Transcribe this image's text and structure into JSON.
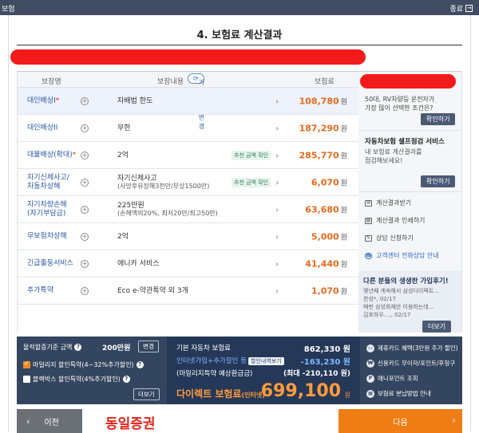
{
  "window": {
    "title": "보험",
    "close_label": "종료",
    "close_icon": "exit-icon"
  },
  "page": {
    "title": "4. 보험료 계산결과"
  },
  "table": {
    "headers": {
      "name": "보장명",
      "coverage": "보장내용",
      "change_amount": "가입금액 변경",
      "premium": "보험료"
    },
    "rows": [
      {
        "name": "대인배상I",
        "required": "*",
        "coverage": "자배법 한도",
        "coverage_sub": "",
        "recommend": "",
        "amount": "108,780",
        "unit": "원"
      },
      {
        "name": "대인배상II",
        "required": "",
        "coverage": "무한",
        "coverage_sub": "",
        "recommend": "",
        "amount": "187,290",
        "unit": "원"
      },
      {
        "name": "대물배상(확대)",
        "required": "*",
        "coverage": "2억",
        "coverage_sub": "",
        "recommend": "추천 금액 확인",
        "amount": "285,770",
        "unit": "원"
      },
      {
        "name": "자기신체사고/",
        "name2": "자동차상해",
        "required": "",
        "coverage": "자기신체사고",
        "coverage_sub": "(사망후유장해3천만/부상1500만)",
        "recommend": "추천 금액 확인",
        "amount": "6,070",
        "unit": "원"
      },
      {
        "name": "자기차량손해",
        "name2": "(자기부담금)",
        "required": "",
        "coverage": "225만원",
        "coverage_sub": "(손해액의20%, 최저20만/최고50만)",
        "recommend": "",
        "amount": "63,680",
        "unit": "원"
      },
      {
        "name": "무보험차상해",
        "required": "",
        "coverage": "2억",
        "coverage_sub": "",
        "recommend": "",
        "amount": "5,000",
        "unit": "원"
      },
      {
        "name": "긴급출동서비스",
        "required": "",
        "coverage": "애니카 서비스",
        "coverage_sub": "",
        "recommend": "",
        "amount": "41,440",
        "unit": "원"
      },
      {
        "name": "추가특약",
        "required": "",
        "coverage": "Eco e-약관특약 외 3개",
        "coverage_sub": "",
        "recommend": "",
        "amount": "1,070",
        "unit": "원"
      }
    ]
  },
  "side": {
    "question_line1": "50대, RV차량등 운전자가",
    "question_line2": "가장 많이 선택한 조건은?",
    "confirm1": "확인하기",
    "check_title": "자동차보험 셀프점검 서비스",
    "check_line1": "내 보험료 계산결과를",
    "check_line2": "점검해보세요!",
    "confirm2": "확인하기",
    "links": [
      "계산결과받기",
      "계산결과 인쇄하기",
      "상담 신청하기"
    ],
    "consult_link": "고객센터 전화상담 안내",
    "review_title": "다른 분들의 생생한 가입후기!",
    "review_line1": "몇년째 계속해서 삼성다이렉트...",
    "review_line2": "찬성*, 02/17",
    "review_line3": "매번 삼성화재만 이용하는데...",
    "review_line4": "김포하우...., 02/17",
    "more": "더보기"
  },
  "summary": {
    "mileage_label": "물적할증기준 금액",
    "mileage_value": "200만원",
    "mileage_change": "변경",
    "option1": "마일리지 할인특약(4~32%추가할인)",
    "option2": "블랙박스 할인특약(4%추가할인)",
    "option1_checked": true,
    "option2_checked": false,
    "more": "더보기",
    "base_label": "기본 자동차 보험료",
    "base_value": "862,330 원",
    "discount_label": "인터넷가입+추가할인 등",
    "discount_btn": "할인내역보기",
    "discount_value": "-163,230 원",
    "mileage_expected": "(마일리지특약 예상환급금)",
    "mileage_expected_value": "(최대 -210,110 원)",
    "direct_label": "다이렉트 보험료",
    "direct_sub": "(인터넷)",
    "direct_value": "699,100",
    "direct_unit": "원",
    "benefits": [
      "제휴카드 혜택(3만원 추가 할인)",
      "신용카드 무이자/포인트/후청구",
      "애니포인트 조회",
      "보험료 분납방법 안내"
    ],
    "benefit_icons": [
      "card-icon",
      "won-icon",
      "point-icon",
      "installment-icon"
    ]
  },
  "nav": {
    "prev": "이전",
    "next": "다음",
    "brand": "동일증권"
  }
}
